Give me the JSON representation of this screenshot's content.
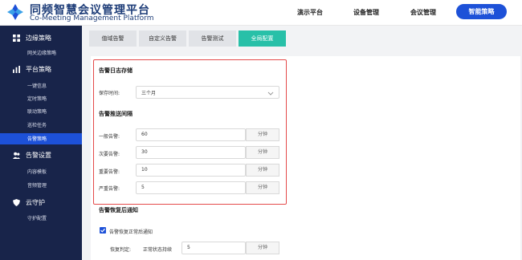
{
  "header": {
    "logo_cn": "同频智慧会议管理平台",
    "logo_en": "Co-Meeting Management Platform",
    "nav": [
      "演示平台",
      "设备管理",
      "会议管理"
    ],
    "nav_active": "智能策略"
  },
  "sidebar": {
    "groups": [
      {
        "label": "边缘策略",
        "icon": "edge-icon",
        "items": [
          "网关边缘策略"
        ]
      },
      {
        "label": "平台策略",
        "icon": "chart-icon",
        "items": [
          "一键信息",
          "定时策略",
          "联动策略",
          "巡检任务",
          "告警策略"
        ]
      },
      {
        "label": "告警设置",
        "icon": "users-icon",
        "items": [
          "内容模板",
          "音频管理"
        ]
      },
      {
        "label": "云守护",
        "icon": "shield-icon",
        "items": [
          "守护配置"
        ]
      }
    ],
    "active_item": "告警策略"
  },
  "tabs": [
    "值域告警",
    "自定义告警",
    "告警测试",
    "全局配置"
  ],
  "active_tab": "全局配置",
  "log_storage": {
    "title": "告警日志存储",
    "label": "保存时间:",
    "value": "三个月"
  },
  "push_interval": {
    "title": "告警推送间隔",
    "rows": [
      {
        "label": "一般告警:",
        "value": "60",
        "unit": "分钟"
      },
      {
        "label": "次要告警:",
        "value": "30",
        "unit": "分钟"
      },
      {
        "label": "重要告警:",
        "value": "10",
        "unit": "分钟"
      },
      {
        "label": "严重告警:",
        "value": "5",
        "unit": "分钟"
      }
    ]
  },
  "recovery": {
    "title": "告警恢复后通知",
    "checkbox_label": "告警恢复正常后通知",
    "checked": true,
    "judge_label": "恢复判定:",
    "judge_sub": "正常状态持续",
    "value": "5",
    "unit": "分钟"
  },
  "colors": {
    "sidebar_bg": "#18244a",
    "accent": "#1d51d8",
    "tab_active": "#28c0a8",
    "highlight_border": "#e44a4a"
  }
}
